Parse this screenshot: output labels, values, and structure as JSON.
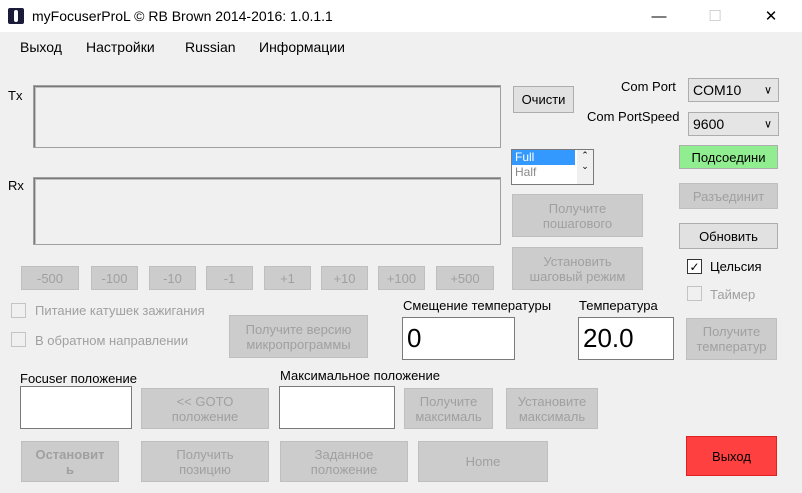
{
  "window": {
    "title": "myFocuserProL © RB Brown 2014-2016: 1.0.1.1",
    "minimize": "—",
    "maximize": "☐",
    "close": "✕"
  },
  "menu": [
    "Выход",
    "Настройки",
    "Russian",
    "Информации"
  ],
  "tx_label": "Tx",
  "rx_label": "Rx",
  "clear_button": "Очисти",
  "com_port": {
    "label": "Com Port",
    "value": "COM10"
  },
  "com_speed": {
    "label": "Com PortSpeed",
    "value": "9600"
  },
  "connect_button": "Подсоедини",
  "disconnect_button": "Разъединит",
  "refresh_button": "Обновить",
  "step_modes": [
    "Full",
    "Half"
  ],
  "get_step_button": "Получите\nпошагового",
  "set_step_button": "Установить\nшаговый режим",
  "step_buttons": [
    "-500",
    "-100",
    "-10",
    "-1",
    "+1",
    "+10",
    "+100",
    "+500"
  ],
  "celsius": {
    "label": "Цельсия",
    "checked": true
  },
  "timer": {
    "label": "Таймер",
    "checked": false
  },
  "coil_power": {
    "label": "Питание катушек зажигания",
    "checked": false
  },
  "reverse": {
    "label": "В обратном направлении",
    "checked": false
  },
  "get_firmware_button": "Получите версию\nмикропрограммы",
  "temp_offset": {
    "label": "Смещение температуры",
    "value": "0"
  },
  "temperature": {
    "label": "Температура",
    "value": "20.0"
  },
  "get_temp_button": "Получите\nтемператур",
  "focuser_position": {
    "label": "Focuser положение",
    "value": ""
  },
  "goto_button": "<< GOTO\nположение",
  "max_position": {
    "label": "Максимальное положение",
    "value": ""
  },
  "get_max_button": "Получите\nмаксималь",
  "set_max_button": "Установите\nмаксималь",
  "stop_button": "Остановит\nь",
  "get_position_button": "Получить\nпозицию",
  "set_position_button": "Заданное\nположение",
  "home_button": "Home",
  "exit_button": "Выход"
}
